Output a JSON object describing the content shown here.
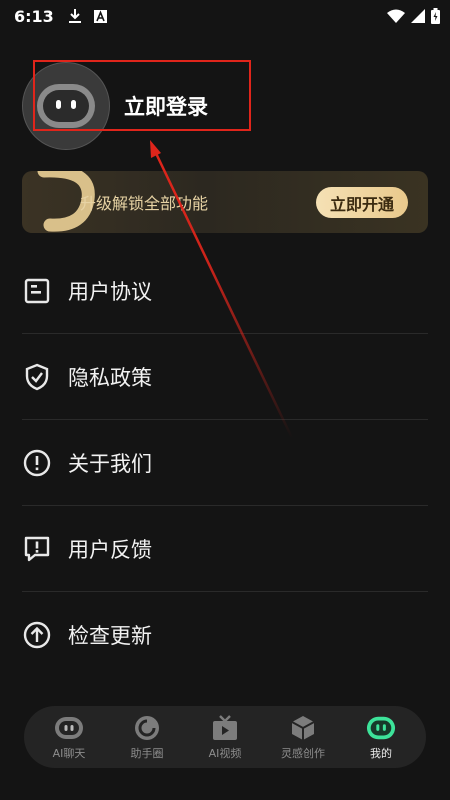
{
  "status_bar": {
    "time": "6:13",
    "icons": [
      "download-icon",
      "a-badge-icon",
      "wifi-icon",
      "signal-icon",
      "battery-charging-icon"
    ]
  },
  "profile": {
    "login_label": "立即登录",
    "avatar_icon": "robot-avatar-icon"
  },
  "vip": {
    "text": "升级解锁全部功能",
    "button_label": "立即开通",
    "colors": {
      "text": "#e7d3a4",
      "button": "#f0d7a2"
    }
  },
  "menu": {
    "items": [
      {
        "label": "用户协议",
        "icon": "document-icon"
      },
      {
        "label": "隐私政策",
        "icon": "shield-check-icon"
      },
      {
        "label": "关于我们",
        "icon": "info-circle-icon"
      },
      {
        "label": "用户反馈",
        "icon": "feedback-icon"
      },
      {
        "label": "检查更新",
        "icon": "upload-circle-icon"
      }
    ]
  },
  "tabs": [
    {
      "label": "AI聊天",
      "icon": "chat-bot-icon",
      "active": false
    },
    {
      "label": "助手圈",
      "icon": "assistant-circle-icon",
      "active": false
    },
    {
      "label": "AI视频",
      "icon": "video-icon",
      "active": false
    },
    {
      "label": "灵感创作",
      "icon": "cube-icon",
      "active": false
    },
    {
      "label": "我的",
      "icon": "profile-bot-icon",
      "active": true
    }
  ],
  "colors": {
    "background": "#141414",
    "accent_green": "#3de39a",
    "annotation_red": "#e0251b"
  }
}
